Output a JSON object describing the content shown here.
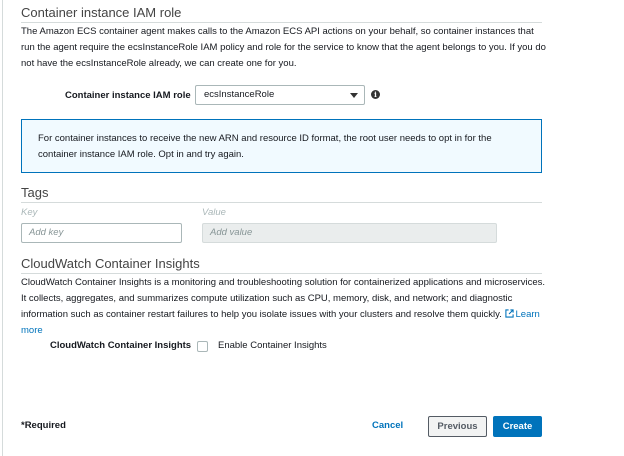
{
  "iam": {
    "title": "Container instance IAM role",
    "description": "The Amazon ECS container agent makes calls to the Amazon ECS API actions on your behalf, so container instances that run the agent require the ecsInstanceRole IAM policy and role for the service to know that the agent belongs to you. If you do not have the ecsInstanceRole already, we can create one for you.",
    "field_label": "Container instance IAM role",
    "selected_value": "ecsInstanceRole",
    "alert_text": "For container instances to receive the new ARN and resource ID format, the root user needs to opt in for the container instance IAM role. Opt in and try again."
  },
  "tags": {
    "title": "Tags",
    "key_label": "Key",
    "value_label": "Value",
    "key_placeholder": "Add key",
    "value_placeholder": "Add value"
  },
  "insights": {
    "title": "CloudWatch Container Insights",
    "description": "CloudWatch Container Insights is a monitoring and troubleshooting solution for containerized applications and microservices. It collects, aggregates, and summarizes compute utilization such as CPU, memory, disk, and network; and diagnostic information such as container restart failures to help you isolate issues with your clusters and resolve them quickly.",
    "learn_more": "Learn more",
    "field_label": "CloudWatch Container Insights",
    "checkbox_label": "Enable Container Insights",
    "checked": false
  },
  "footer": {
    "required": "*Required",
    "cancel": "Cancel",
    "previous": "Previous",
    "create": "Create"
  },
  "colors": {
    "accent": "#0073bb",
    "alert_bg": "#f1faff",
    "border": "#aab7b8"
  }
}
